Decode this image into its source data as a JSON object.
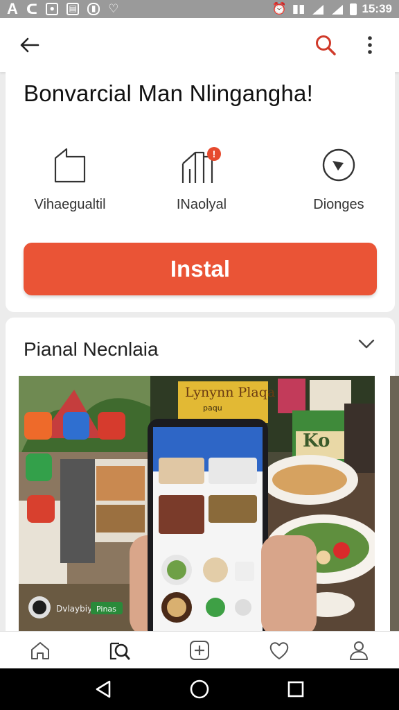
{
  "status_bar": {
    "left_icons": [
      "a-letter-icon",
      "c-letter-icon",
      "notification-icon",
      "photo-icon",
      "lock-icon",
      "location-icon"
    ],
    "time": "15:39"
  },
  "app_bar": {
    "back_icon": "back-arrow-icon",
    "search_icon": "search-icon",
    "menu_icon": "overflow-menu-icon"
  },
  "app": {
    "title": "Bonvarcial Man Nlingangha!",
    "features": [
      {
        "icon": "document-icon",
        "label": "Vihaegualtil"
      },
      {
        "icon": "chart-icon",
        "label": "INaolyal",
        "badge": "!"
      },
      {
        "icon": "compass-icon",
        "label": "Dionges"
      }
    ],
    "install_label": "Instal"
  },
  "feed": {
    "title": "Pianal Necnlaia",
    "hero_sign_text": "Lynynn Plaqa",
    "hero_sign_sub": "paqu",
    "hero_poster_text": "Ko",
    "hero_caption": "Dvlaybiy",
    "hero_caption_chip": "Pinas"
  },
  "bottom_nav": [
    {
      "icon": "home-icon"
    },
    {
      "icon": "search-icon"
    },
    {
      "icon": "add-icon"
    },
    {
      "icon": "heart-icon"
    },
    {
      "icon": "profile-icon"
    }
  ],
  "system_nav": [
    "back-triangle-icon",
    "home-circle-icon",
    "recents-square-icon"
  ],
  "colors": {
    "accent": "#ea5436",
    "search_icon": "#d03a2a",
    "badge": "#e64a2e",
    "status_bar": "#9a9a9a"
  }
}
